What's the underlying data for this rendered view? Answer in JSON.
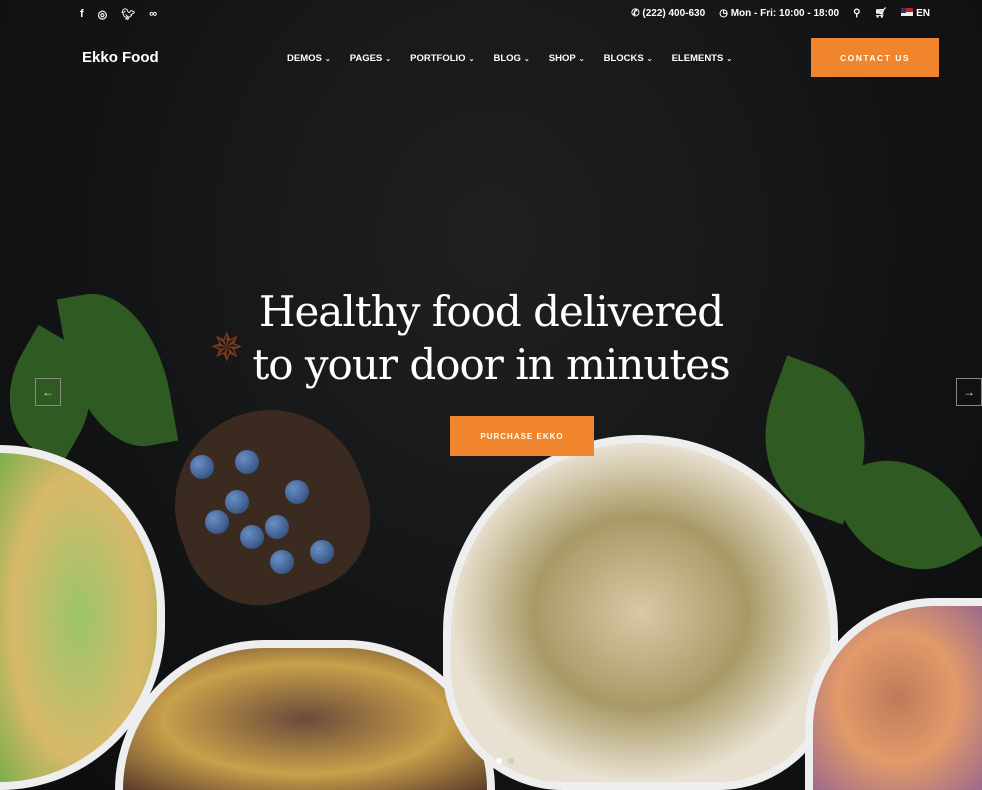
{
  "topbar": {
    "social": [
      "facebook-icon",
      "instagram-icon",
      "twitter-icon",
      "tripadvisor-icon"
    ],
    "phone": "(222) 400-630",
    "hours": "Mon - Fri: 10:00 - 18:00",
    "language": "EN"
  },
  "header": {
    "logo": "Ekko Food",
    "nav": [
      "DEMOS",
      "PAGES",
      "PORTFOLIO",
      "BLOG",
      "SHOP",
      "BLOCKS",
      "ELEMENTS"
    ],
    "contact_label": "CONTACT US"
  },
  "hero": {
    "title_line1": "Healthy food delivered",
    "title_line2": "to your door in minutes",
    "button_label": "PURCHASE EKKO",
    "prev": "←",
    "next": "→"
  },
  "colors": {
    "accent": "#f0852d",
    "background": "#121314"
  }
}
